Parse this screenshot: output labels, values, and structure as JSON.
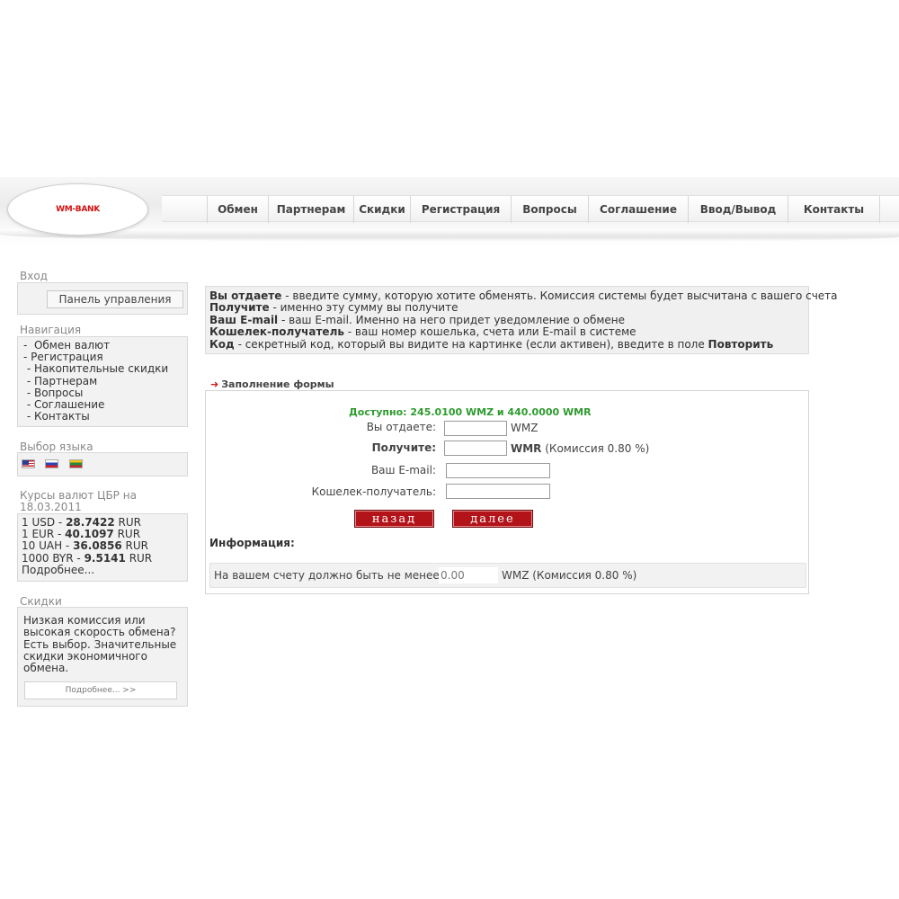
{
  "header": {
    "logo_text": "WM-BANK",
    "nav": [
      "Обмен",
      "Партнерам",
      "Скидки",
      "Регистрация",
      "Вопросы",
      "Соглашение",
      "Ввод/Вывод",
      "Контакты"
    ]
  },
  "sidebar": {
    "login": {
      "title": "Вход",
      "button": "Панель управления"
    },
    "navigation": {
      "title": "Навигация",
      "items": [
        "-  Обмен валют",
        "- Регистрация",
        " - Накопительные скидки",
        " - Партнерам",
        " - Вопросы",
        " - Соглашение",
        " - Контакты"
      ]
    },
    "language": {
      "title": "Выбор языка",
      "flags": [
        "us-flag-icon",
        "ru-flag-icon",
        "lt-flag-icon"
      ]
    },
    "rates": {
      "title_line1": "Курсы валют ЦБР на",
      "title_line2": "18.03.2011",
      "rows": [
        {
          "prefix": "1 USD - ",
          "value": "28.7422",
          "unit": " RUR"
        },
        {
          "prefix": "1 EUR - ",
          "value": "40.1097",
          "unit": " RUR"
        },
        {
          "prefix": "10 UAH - ",
          "value": "36.0856",
          "unit": " RUR"
        },
        {
          "prefix": "1000 BYR - ",
          "value": "9.5141",
          "unit": " RUR"
        }
      ],
      "more": "Подробнее..."
    },
    "discounts": {
      "title": "Скидки",
      "text": "Низкая комиссия или высокая скорость обмена? Есть выбор. Значительные скидки экономичного обмена.",
      "more": "Подробнее... >>"
    }
  },
  "info": {
    "lines": [
      {
        "term": "Вы отдаете",
        "desc": " - введите сумму, которую хотите обменять. Комиссия системы будет высчитана с вашего счета"
      },
      {
        "term": "Получите",
        "desc": " - именно эту сумму вы получите"
      },
      {
        "term": "Ваш E-mail",
        "desc": " - ваш E-mail. Именно на него придет уведомление о обмене"
      },
      {
        "term": "Кошелек-получатель",
        "desc": " - ваш номер кошелька, счета или E-mail в системе"
      },
      {
        "term": "Код",
        "desc": " - секретный код, который вы видите на картинке (если активен), введите в поле ",
        "extra": "Повторить"
      }
    ]
  },
  "form": {
    "heading": "Заполнение формы",
    "available": "Доступно: 245.0100 WMZ и 440.0000 WMR",
    "give_label": "Вы отдаете:",
    "give_value": "",
    "give_currency": "WMZ",
    "get_label": "Получите:",
    "get_value": "",
    "get_currency": "WMR",
    "get_commission": " (Комиссия 0.80 %)",
    "email_label": "Ваш E-mail:",
    "email_value": "",
    "wallet_label": "Кошелек-получатель:",
    "wallet_value": "",
    "back_button": "назад",
    "next_button": "далее",
    "info_label": "Информация:",
    "balance_text": "На вашем счету должно быть не менее:",
    "balance_value": "0.00",
    "balance_suffix": "WMZ (Комиссия 0.80 %)"
  }
}
